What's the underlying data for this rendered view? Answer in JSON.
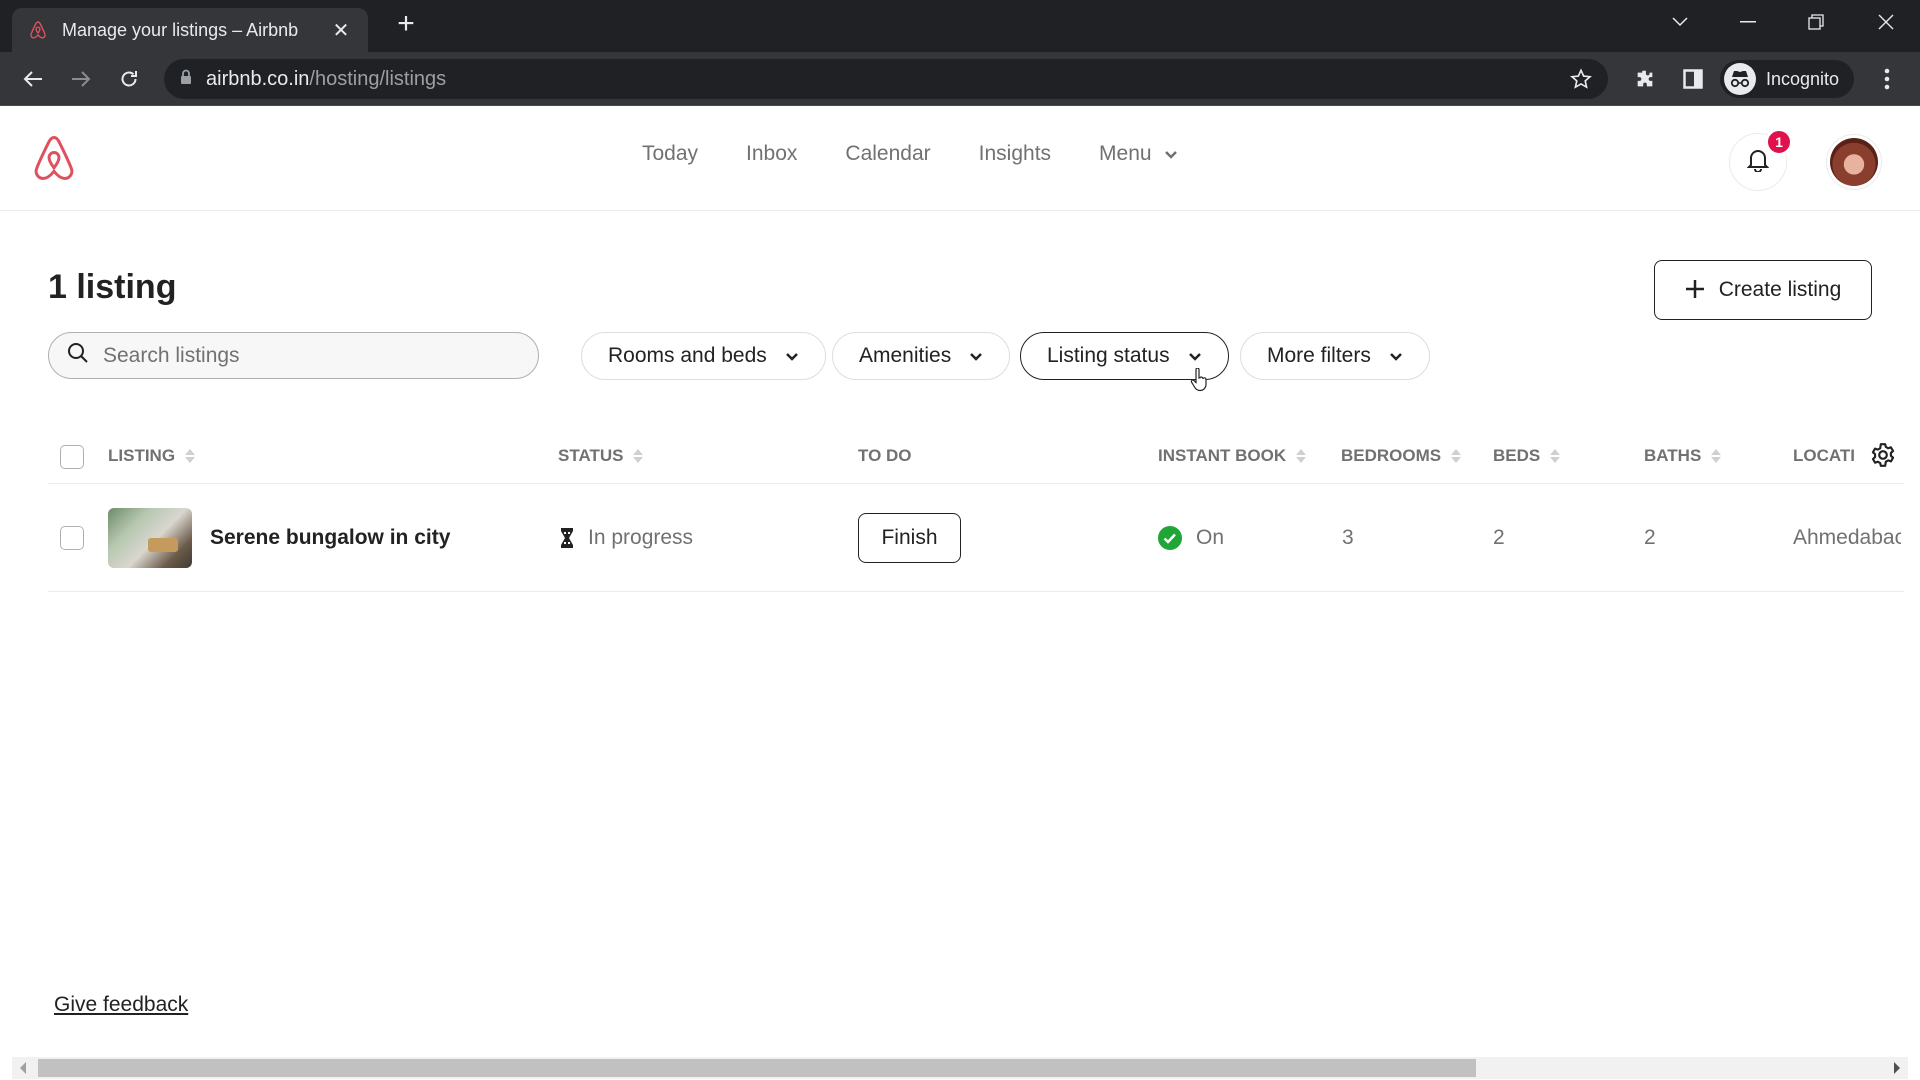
{
  "browser": {
    "tab_title": "Manage your listings – Airbnb",
    "url_host": "airbnb.co.in",
    "url_path": "/hosting/listings",
    "profile_label": "Incognito"
  },
  "header": {
    "nav": [
      {
        "label": "Today"
      },
      {
        "label": "Inbox"
      },
      {
        "label": "Calendar"
      },
      {
        "label": "Insights"
      },
      {
        "label": "Menu"
      }
    ],
    "notification_count": "1",
    "brand_color": "#e0515f"
  },
  "main": {
    "title": "1 listing",
    "create_button": "Create listing",
    "search": {
      "placeholder": "Search listings",
      "value": ""
    },
    "filters": [
      {
        "label": "Rooms and beds",
        "active": false
      },
      {
        "label": "Amenities",
        "active": false
      },
      {
        "label": "Listing status",
        "active": true
      },
      {
        "label": "More filters",
        "active": false
      }
    ]
  },
  "table": {
    "columns": [
      {
        "label": "LISTING",
        "sortable": true
      },
      {
        "label": "STATUS",
        "sortable": true
      },
      {
        "label": "TO DO",
        "sortable": false
      },
      {
        "label": "INSTANT BOOK",
        "sortable": true
      },
      {
        "label": "BEDROOMS",
        "sortable": true
      },
      {
        "label": "BEDS",
        "sortable": true
      },
      {
        "label": "BATHS",
        "sortable": true
      },
      {
        "label": "LOCATI",
        "sortable": false
      }
    ],
    "rows": [
      {
        "name": "Serene bungalow in city",
        "status": "In progress",
        "todo_action": "Finish",
        "instant_book": "On",
        "bedrooms": "3",
        "beds": "2",
        "baths": "2",
        "location": "Ahmedabac"
      }
    ]
  },
  "footer": {
    "feedback_link": "Give feedback"
  }
}
